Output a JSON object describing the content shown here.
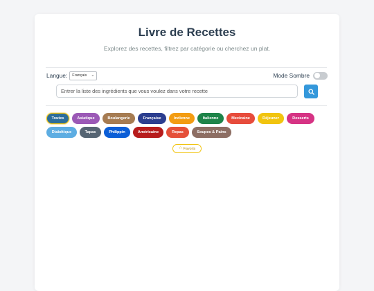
{
  "header": {
    "title": "Livre de Recettes",
    "subtitle": "Explorez des recettes, filtrez par catégorie ou cherchez un plat."
  },
  "settings": {
    "language_label": "Langue:",
    "language_selected": "Français",
    "dark_mode_label": "Mode Sombre",
    "dark_mode_on": false
  },
  "search": {
    "placeholder": "Entrer la liste des ingrédients que vous voulez dans votre recette",
    "button_icon": "search-icon"
  },
  "categories": [
    {
      "label": "Toutes",
      "color": "#2c6e9b",
      "active": true
    },
    {
      "label": "Asiatique",
      "color": "#9b59b6"
    },
    {
      "label": "Boulangerie",
      "color": "#a67c52"
    },
    {
      "label": "Française",
      "color": "#2c3e8f"
    },
    {
      "label": "Indienne",
      "color": "#f39c12"
    },
    {
      "label": "Italienne",
      "color": "#1e8449"
    },
    {
      "label": "Mexicaine",
      "color": "#e74c3c"
    },
    {
      "label": "Déjeuner",
      "color": "#f1c40f"
    },
    {
      "label": "Desserts",
      "color": "#d63384"
    },
    {
      "label": "Diabétique",
      "color": "#5dade2"
    },
    {
      "label": "Tapas",
      "color": "#566573"
    },
    {
      "label": "Philippin",
      "color": "#0b5ed7"
    },
    {
      "label": "Américaine",
      "color": "#b71c1c"
    },
    {
      "label": "Repas",
      "color": "#e55039"
    },
    {
      "label": "Soupes & Pains",
      "color": "#8d6e63"
    }
  ],
  "favorites": {
    "label": "Favoris",
    "icon": "star-icon",
    "color": "#f1c40f"
  }
}
